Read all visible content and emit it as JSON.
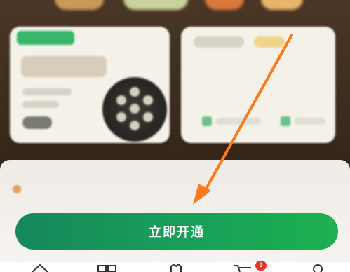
{
  "primary_button": {
    "label": "立即开通"
  },
  "cart": {
    "badge_count": "1"
  },
  "bottom_nav": {
    "icons": [
      "home-icon",
      "category-icon",
      "member-icon",
      "cart-icon",
      "profile-icon"
    ]
  },
  "colors": {
    "primary_green": "#18a05a",
    "arrow": "#ff7a1a",
    "badge_red": "#e8322b"
  }
}
